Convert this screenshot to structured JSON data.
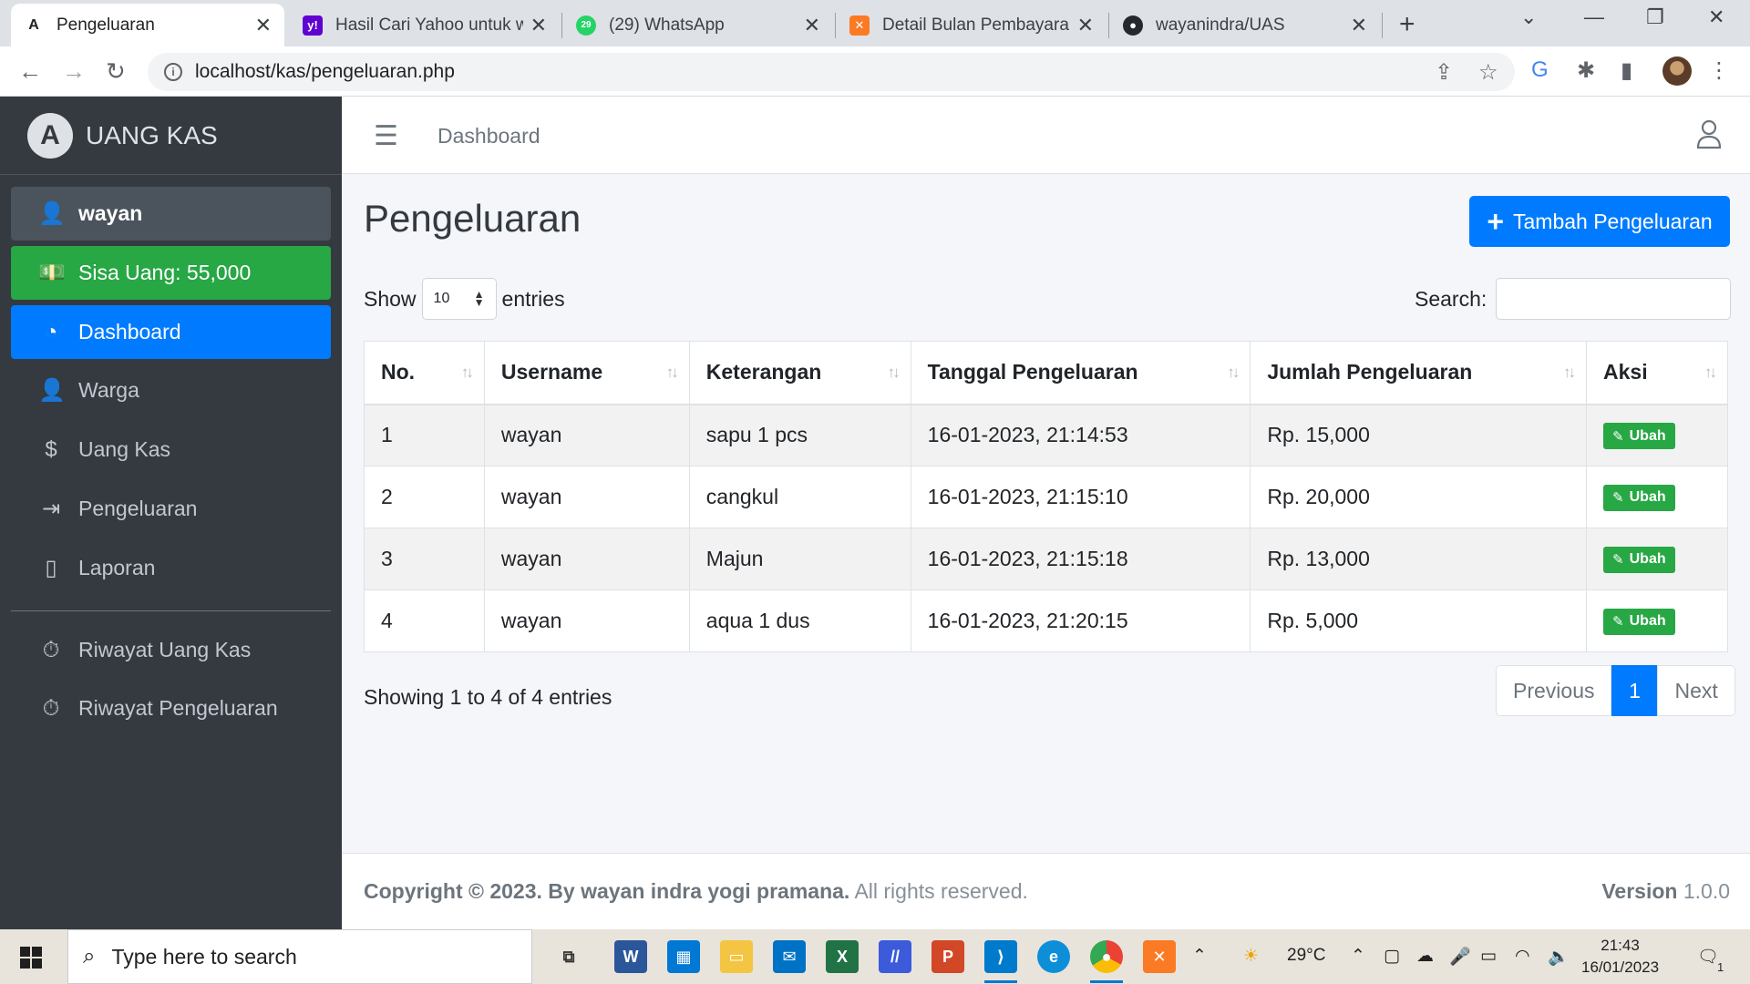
{
  "browser": {
    "tabs": [
      {
        "title": "Pengeluaran",
        "icon": "adminlte-favicon-icon",
        "active": true
      },
      {
        "title": "Hasil Cari Yahoo untuk wa",
        "icon": "yahoo-icon",
        "active": false
      },
      {
        "title": "(29) WhatsApp",
        "icon": "whatsapp-icon",
        "badge": "29",
        "active": false
      },
      {
        "title": "Detail Bulan Pembayaran",
        "icon": "xampp-icon",
        "active": false
      },
      {
        "title": "wayanindra/UAS",
        "icon": "github-icon",
        "active": false
      }
    ],
    "url": "localhost/kas/pengeluaran.php"
  },
  "sidebar": {
    "brand": "UANG KAS",
    "user": "wayan",
    "saldo": "Sisa Uang: 55,000",
    "items": [
      {
        "label": "Dashboard",
        "icon": "dashboard-icon",
        "active": true
      },
      {
        "label": "Warga",
        "icon": "user-tie-icon"
      },
      {
        "label": "Uang Kas",
        "icon": "dollar-icon"
      },
      {
        "label": "Pengeluaran",
        "icon": "sign-out-icon"
      },
      {
        "label": "Laporan",
        "icon": "file-icon"
      }
    ],
    "history": [
      {
        "label": "Riwayat Uang Kas",
        "icon": "stopwatch-icon"
      },
      {
        "label": "Riwayat Pengeluaran",
        "icon": "stopwatch-icon"
      }
    ]
  },
  "topnav": {
    "breadcrumb": "Dashboard"
  },
  "main": {
    "title": "Pengeluaran",
    "add_button": "Tambah Pengeluaran",
    "show_label": "Show",
    "entries_label": "entries",
    "page_length": "10",
    "search_label": "Search:",
    "search_value": "",
    "columns": [
      "No.",
      "Username",
      "Keterangan",
      "Tanggal Pengeluaran",
      "Jumlah Pengeluaran",
      "Aksi"
    ],
    "rows": [
      {
        "no": "1",
        "username": "wayan",
        "keterangan": "sapu 1 pcs",
        "tanggal": "16-01-2023, 21:14:53",
        "jumlah": "Rp. 15,000",
        "aksi": "Ubah"
      },
      {
        "no": "2",
        "username": "wayan",
        "keterangan": "cangkul",
        "tanggal": "16-01-2023, 21:15:10",
        "jumlah": "Rp. 20,000",
        "aksi": "Ubah"
      },
      {
        "no": "3",
        "username": "wayan",
        "keterangan": "Majun",
        "tanggal": "16-01-2023, 21:15:18",
        "jumlah": "Rp. 13,000",
        "aksi": "Ubah"
      },
      {
        "no": "4",
        "username": "wayan",
        "keterangan": "aqua 1 dus",
        "tanggal": "16-01-2023, 21:20:15",
        "jumlah": "Rp. 5,000",
        "aksi": "Ubah"
      }
    ],
    "info": "Showing 1 to 4 of 4 entries",
    "pagination": {
      "previous": "Previous",
      "current": "1",
      "next": "Next"
    }
  },
  "footer": {
    "copyright": "Copyright © 2023. By wayan indra yogi pramana.",
    "rights": " All rights reserved.",
    "version_label": "Version",
    "version": " 1.0.0"
  },
  "taskbar": {
    "search_placeholder": "Type here to search",
    "weather": "29°C",
    "time": "21:43",
    "date": "16/01/2023",
    "notification_count": "1"
  },
  "colors": {
    "sidebar_bg": "#343a40",
    "primary": "#007bff",
    "success": "#28a745"
  }
}
